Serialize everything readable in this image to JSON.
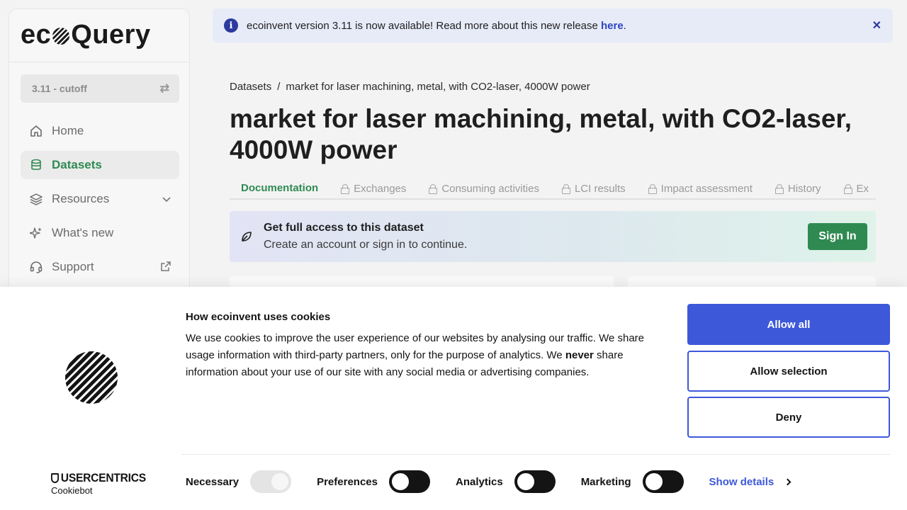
{
  "sidebar": {
    "logo": {
      "left": "ec",
      "right": "Query"
    },
    "version": "3.11 - cutoff",
    "items": [
      {
        "label": "Home",
        "icon": "home-icon"
      },
      {
        "label": "Datasets",
        "icon": "database-icon"
      },
      {
        "label": "Resources",
        "icon": "layers-icon"
      },
      {
        "label": "What's new",
        "icon": "sparkle-icon"
      },
      {
        "label": "Support",
        "icon": "headset-icon"
      }
    ]
  },
  "banner": {
    "text": "ecoinvent version 3.11 is now available! Read more about this new release ",
    "link": "here",
    "suffix": "."
  },
  "breadcrumb": {
    "root": "Datasets",
    "sep": "/",
    "current": "market for laser machining, metal, with CO2-laser, 4000W power"
  },
  "page_title": "market for laser machining, metal, with CO2-laser, 4000W power",
  "tabs": [
    "Documentation",
    "Exchanges",
    "Consuming activities",
    "LCI results",
    "Impact assessment",
    "History",
    "Ex"
  ],
  "access": {
    "title": "Get full access to this dataset",
    "subtitle": "Create an account or sign in to continue.",
    "button": "Sign In"
  },
  "cookie": {
    "title": "How ecoinvent uses cookies",
    "body_1": "We use cookies to improve the user experience of our websites by analysing our traffic. We share usage information with third-party partners, only for the purpose of analytics. We ",
    "body_bold": "never",
    "body_2": " share information about your use of our site with any social media or advertising companies.",
    "allow_all": "Allow all",
    "allow_selection": "Allow selection",
    "deny": "Deny",
    "brand": "USERCENTRICS",
    "brand_sub": "Cookiebot",
    "toggles": [
      "Necessary",
      "Preferences",
      "Analytics",
      "Marketing"
    ],
    "show_details": "Show details"
  },
  "colors": {
    "accent_green": "#2f8a52",
    "accent_blue": "#3d58d9",
    "banner_bg": "#e7ebf8"
  }
}
